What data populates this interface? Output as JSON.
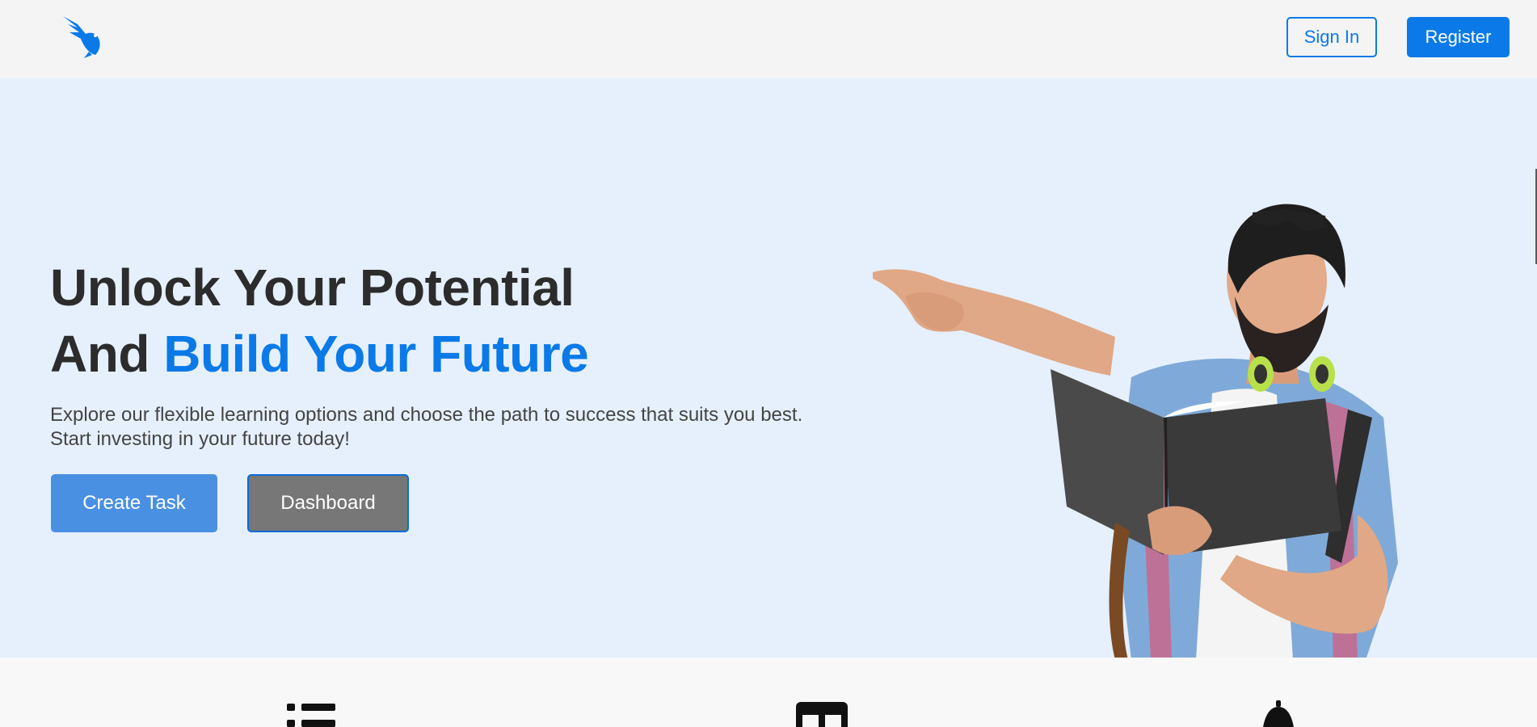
{
  "header": {
    "logo_icon": "bird-logo-icon",
    "signin_label": "Sign In",
    "register_label": "Register"
  },
  "hero": {
    "headline_line1": "Unlock Your Potential",
    "headline_line2_prefix": "And ",
    "headline_line2_accent": "Build Your Future",
    "subtext": "Explore our flexible learning options and choose the path to success that suits you best. Start investing in your future today!",
    "create_task_label": "Create Task",
    "dashboard_label": "Dashboard",
    "image_icon": "student-pointing-with-book-image"
  },
  "features": {
    "icons": [
      "list-icon",
      "board-icon",
      "bell-icon"
    ]
  },
  "colors": {
    "accent": "#0b7ae8",
    "hero_background": "#e6f0fd",
    "header_background": "#f4f4f4",
    "create_button": "#4a90e2",
    "dashboard_button": "#777777",
    "headline_text": "#2c2c2c"
  }
}
